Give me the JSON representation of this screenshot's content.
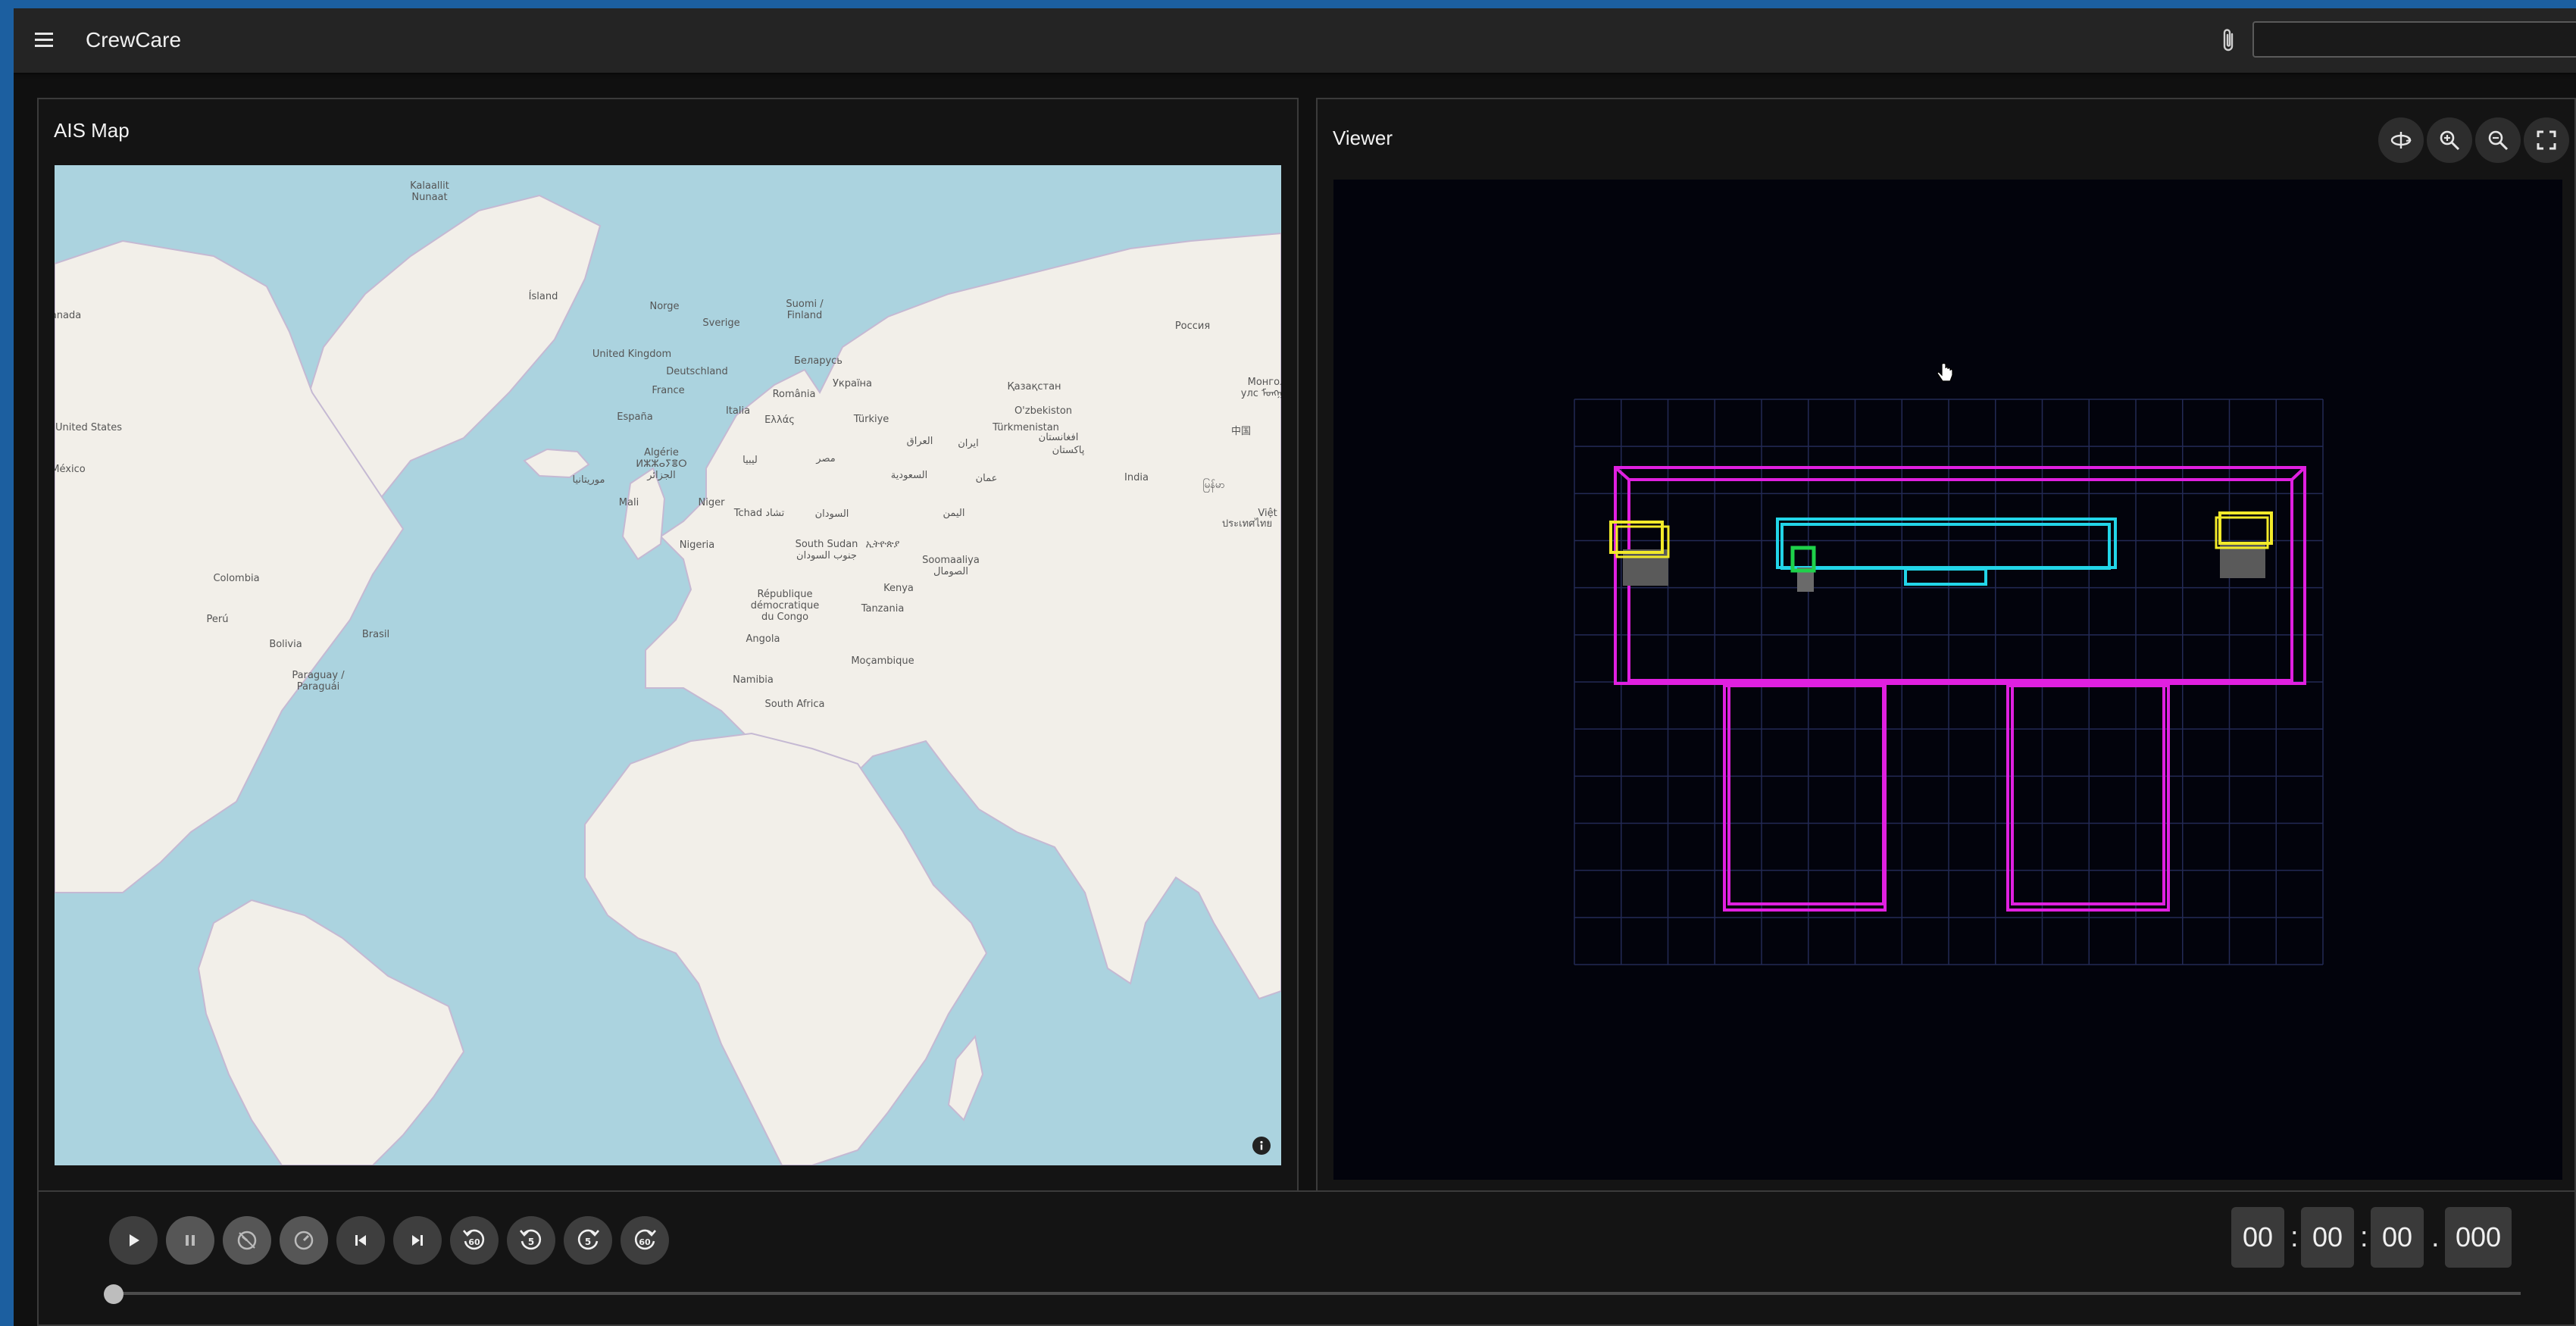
{
  "app": {
    "title": "CrewCare",
    "search_value": ""
  },
  "map_panel": {
    "title": "AIS Map",
    "labels": [
      {
        "id": "kalaallit",
        "text": "Kalaallit\nNunaat"
      },
      {
        "id": "island",
        "text": "Ísland"
      },
      {
        "id": "norge",
        "text": "Norge"
      },
      {
        "id": "suomi",
        "text": "Suomi /\nFinland"
      },
      {
        "id": "sverige",
        "text": "Sverige"
      },
      {
        "id": "russia",
        "text": "Россия"
      },
      {
        "id": "canada",
        "text": "anada"
      },
      {
        "id": "uk",
        "text": "United Kingdom"
      },
      {
        "id": "belarus",
        "text": "Беларусь"
      },
      {
        "id": "deutschland",
        "text": "Deutschland"
      },
      {
        "id": "ukraine",
        "text": "Україна"
      },
      {
        "id": "kazakhstan",
        "text": "Қазақстан"
      },
      {
        "id": "france",
        "text": "France"
      },
      {
        "id": "romania",
        "text": "România"
      },
      {
        "id": "mongolia",
        "text": "Монгол\nулс ᠮᠣᠩᠭᠣᠯ"
      },
      {
        "id": "espana",
        "text": "España"
      },
      {
        "id": "italia",
        "text": "Italia"
      },
      {
        "id": "turkiye",
        "text": "Türkiye"
      },
      {
        "id": "uzbekistan",
        "text": "O'zbekiston"
      },
      {
        "id": "ellas",
        "text": "Ελλάς"
      },
      {
        "id": "turkmenistan",
        "text": "Türkmenistan"
      },
      {
        "id": "us",
        "text": "United States"
      },
      {
        "id": "china",
        "text": "中国"
      },
      {
        "id": "iraq",
        "text": "العراق"
      },
      {
        "id": "afghanistan",
        "text": "افغانستان"
      },
      {
        "id": "iran",
        "text": "ایران"
      },
      {
        "id": "algerie",
        "text": "Algérie\nⵍⵣⵣⴰⵢⴻⵔ\nالجزائر"
      },
      {
        "id": "libya",
        "text": "ليبيا"
      },
      {
        "id": "misr",
        "text": "مصر"
      },
      {
        "id": "pakistan",
        "text": "پاکستان"
      },
      {
        "id": "saudi",
        "text": "السعودية"
      },
      {
        "id": "mexico",
        "text": "México"
      },
      {
        "id": "mauritania",
        "text": "موريتانيا"
      },
      {
        "id": "mali",
        "text": "Mali"
      },
      {
        "id": "niger",
        "text": "Niger"
      },
      {
        "id": "tchad",
        "text": "Tchad تشاد"
      },
      {
        "id": "sudan",
        "text": "السودان"
      },
      {
        "id": "yemen",
        "text": "اليمن"
      },
      {
        "id": "oman",
        "text": "عمان"
      },
      {
        "id": "india",
        "text": "India"
      },
      {
        "id": "myanmar",
        "text": "မြန်မာ"
      },
      {
        "id": "vietnam",
        "text": "Việt N"
      },
      {
        "id": "thailand",
        "text": "ประเทศไทย"
      },
      {
        "id": "nigeria",
        "text": "Nigeria"
      },
      {
        "id": "southsudan",
        "text": "South Sudan\nجنوب السودان"
      },
      {
        "id": "ethiopia",
        "text": "ኢትዮጵያ"
      },
      {
        "id": "somalia",
        "text": "Soomaaliya\nالصومال"
      },
      {
        "id": "colombia",
        "text": "Colombia"
      },
      {
        "id": "kenya",
        "text": "Kenya"
      },
      {
        "id": "rdc",
        "text": "République\ndémocratique\ndu Congo"
      },
      {
        "id": "tanzania",
        "text": "Tanzania"
      },
      {
        "id": "peru",
        "text": "Perú"
      },
      {
        "id": "brasil",
        "text": "Brasil"
      },
      {
        "id": "bolivia",
        "text": "Bolivia"
      },
      {
        "id": "angola",
        "text": "Angola"
      },
      {
        "id": "mocambique",
        "text": "Moçambique"
      },
      {
        "id": "paraguay",
        "text": "Paraguay /\nParaguái"
      },
      {
        "id": "namibia",
        "text": "Namibia"
      },
      {
        "id": "southafrica",
        "text": "South Africa"
      }
    ]
  },
  "viewer_panel": {
    "title": "Viewer",
    "buttons": [
      "rotate-view-icon",
      "zoom-in-icon",
      "zoom-out-icon",
      "fullscreen-icon"
    ]
  },
  "playback": {
    "buttons": [
      {
        "name": "play",
        "dim": false
      },
      {
        "name": "pause",
        "dim": true
      },
      {
        "name": "slow-down",
        "dim": true
      },
      {
        "name": "speed",
        "dim": true
      },
      {
        "name": "skip-to-start",
        "dim": false
      },
      {
        "name": "skip-to-end",
        "dim": false
      },
      {
        "name": "rewind-60",
        "label": "60",
        "dim": false
      },
      {
        "name": "rewind-5",
        "label": "5",
        "dim": false
      },
      {
        "name": "forward-5",
        "label": "5",
        "dim": false
      },
      {
        "name": "forward-60",
        "label": "60",
        "dim": false
      }
    ],
    "progress": 0,
    "time": {
      "hours": "00",
      "minutes": "00",
      "seconds": "00",
      "milliseconds": "000",
      "sep1": ":",
      "sep2": ":",
      "sep3": "."
    }
  },
  "colors": {
    "ocean": "#abd3df",
    "land": "#f2efe9",
    "border": "#b9a9c9",
    "magenta": "#e020e0",
    "cyan": "#22d5e8",
    "yellow": "#f2ea2a",
    "green": "#1ed24a",
    "grid": "#232a55"
  }
}
